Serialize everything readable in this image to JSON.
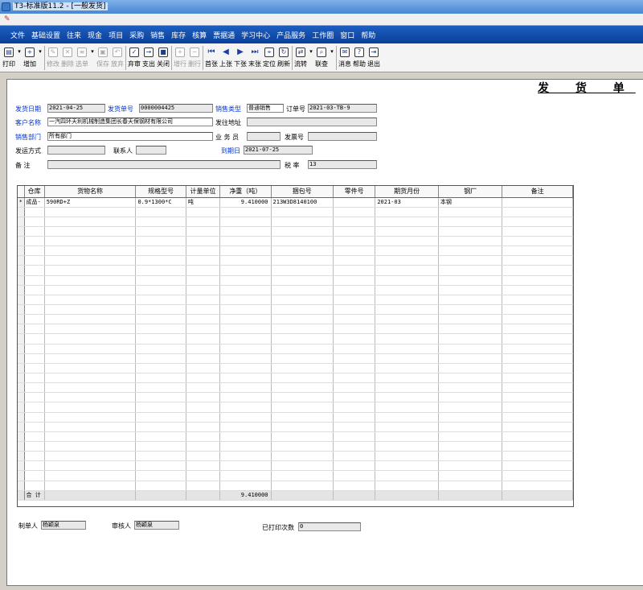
{
  "window": {
    "title": "T3-标准版11.2 - [一般发货]"
  },
  "menu": [
    "文件",
    "基础设置",
    "往来",
    "现金",
    "项目",
    "采购",
    "销售",
    "库存",
    "核算",
    "票据通",
    "学习中心",
    "产品服务",
    "工作圈",
    "窗口",
    "帮助"
  ],
  "toolbar": [
    {
      "label": "打印",
      "icon": "printer-icon",
      "glyph": "▤",
      "drop": true
    },
    {
      "label": "增加",
      "icon": "add-doc-icon",
      "glyph": "+",
      "drop": true
    },
    {
      "label": "修改",
      "icon": "edit-icon",
      "glyph": "✎",
      "disabled": true
    },
    {
      "label": "删除",
      "icon": "delete-icon",
      "glyph": "✕",
      "disabled": true
    },
    {
      "label": "选单",
      "icon": "select-doc-icon",
      "glyph": "≡",
      "disabled": true,
      "drop": true
    },
    {
      "label": "保存",
      "icon": "save-icon",
      "glyph": "▣",
      "disabled": true
    },
    {
      "label": "放弃",
      "icon": "undo-icon",
      "glyph": "↶",
      "disabled": true
    },
    {
      "label": "弃审",
      "icon": "unapprove-icon",
      "glyph": "✓"
    },
    {
      "label": "支出",
      "icon": "expense-icon",
      "glyph": "→"
    },
    {
      "label": "关闭",
      "icon": "close-doc-icon",
      "glyph": "■"
    },
    {
      "label": "增行",
      "icon": "add-row-icon",
      "glyph": "+",
      "disabled": true
    },
    {
      "label": "删行",
      "icon": "delete-row-icon",
      "glyph": "−",
      "disabled": true
    },
    {
      "label": "首张",
      "icon": "first-icon",
      "glyph": "⏮",
      "arrow": true
    },
    {
      "label": "上张",
      "icon": "prev-icon",
      "glyph": "◀",
      "arrow": true
    },
    {
      "label": "下张",
      "icon": "next-icon",
      "glyph": "▶",
      "arrow": true
    },
    {
      "label": "末张",
      "icon": "last-icon",
      "glyph": "⏭",
      "arrow": true
    },
    {
      "label": "定位",
      "icon": "locate-icon",
      "glyph": "⌖"
    },
    {
      "label": "刷新",
      "icon": "refresh-icon",
      "glyph": "↻"
    },
    {
      "label": "流转",
      "icon": "flow-icon",
      "glyph": "⇄",
      "drop": true
    },
    {
      "label": "联查",
      "icon": "linked-query-icon",
      "glyph": "⌕",
      "drop": true
    },
    {
      "label": "消息",
      "icon": "message-icon",
      "glyph": "✉"
    },
    {
      "label": "帮助",
      "icon": "help-icon",
      "glyph": "?"
    },
    {
      "label": "退出",
      "icon": "exit-icon",
      "glyph": "⇥"
    }
  ],
  "document": {
    "title": "发 货 单",
    "fields": {
      "ship_date_label": "发货日期",
      "ship_date": "2021-04-25",
      "ship_no_label": "发货单号",
      "ship_no": "0000004425",
      "sale_type_label": "销售类型",
      "sale_type": "普通销售",
      "order_no_label": "订单号",
      "order_no": "2021-03-TB-9",
      "customer_label": "客户名称",
      "customer": "一汽四环天利机械制造集团长春天保钢材有限公司",
      "address_label": "发往地址",
      "address": "",
      "dept_label": "销售部门",
      "dept": "所有部门",
      "salesperson_label": "业 务 员",
      "salesperson": "",
      "invoice_no_label": "发票号",
      "invoice_no": "",
      "ship_method_label": "发运方式",
      "ship_method": "",
      "contact_label": "联系人",
      "contact": "",
      "due_date_label": "到期日",
      "due_date": "2021-07-25",
      "remark_label": "备    注",
      "remark": "",
      "tax_label": "税  率",
      "tax": "13"
    }
  },
  "grid": {
    "columns": [
      "仓库",
      "货物名称",
      "规格型号",
      "计量单位",
      "净重（吨）",
      "捆包号",
      "零件号",
      "期货月份",
      "钢厂",
      "备注"
    ],
    "rows": [
      [
        "成品-",
        "590RD+Z",
        "0.9*1300*C",
        "吨",
        "9.410000",
        "213W3D8140100",
        "",
        "2021-03",
        "本钢",
        ""
      ]
    ],
    "row_marker": "*",
    "total_label": "合 计",
    "total_weight": "9.410000"
  },
  "footer": {
    "maker_label": "制单人",
    "maker": "杨颖泉",
    "approver_label": "审核人",
    "approver": "杨颖泉",
    "printed_label": "已打印次数",
    "printed": "0"
  }
}
